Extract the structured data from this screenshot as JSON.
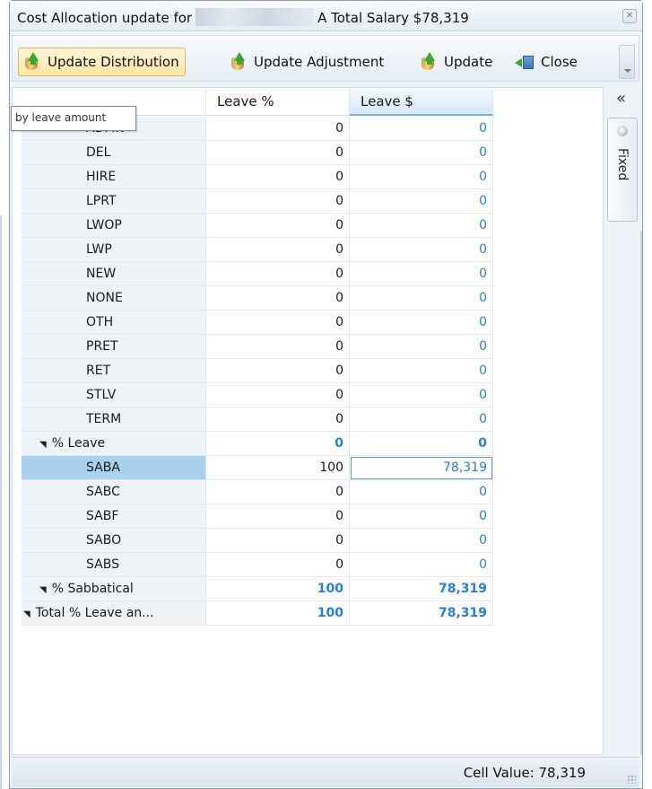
{
  "window": {
    "title_prefix": "Cost Allocation update for",
    "title_suffix": "A Total Salary $78,319",
    "close_glyph": "✕"
  },
  "toolbar": {
    "update_distribution": "Update Distribution",
    "update_adjustment": "Update Adjustment",
    "update": "Update",
    "close": "Close"
  },
  "tooltip": "by leave amount",
  "grid": {
    "headers": [
      "",
      "Leave %",
      "Leave $"
    ],
    "rows": [
      {
        "label": "ADMN",
        "pct": "0",
        "amt": "0"
      },
      {
        "label": "DEL",
        "pct": "0",
        "amt": "0"
      },
      {
        "label": "HIRE",
        "pct": "0",
        "amt": "0"
      },
      {
        "label": "LPRT",
        "pct": "0",
        "amt": "0"
      },
      {
        "label": "LWOP",
        "pct": "0",
        "amt": "0"
      },
      {
        "label": "LWP",
        "pct": "0",
        "amt": "0"
      },
      {
        "label": "NEW",
        "pct": "0",
        "amt": "0"
      },
      {
        "label": "NONE",
        "pct": "0",
        "amt": "0"
      },
      {
        "label": "OTH",
        "pct": "0",
        "amt": "0"
      },
      {
        "label": "PRET",
        "pct": "0",
        "amt": "0"
      },
      {
        "label": "RET",
        "pct": "0",
        "amt": "0"
      },
      {
        "label": "STLV",
        "pct": "0",
        "amt": "0"
      },
      {
        "label": "TERM",
        "pct": "0",
        "amt": "0"
      },
      {
        "label": "% Leave",
        "pct": "0",
        "amt": "0",
        "subtotal": true,
        "indent": 0
      },
      {
        "label": "SABA",
        "pct": "100",
        "amt": "78,319",
        "selected": true
      },
      {
        "label": "SABC",
        "pct": "0",
        "amt": "0"
      },
      {
        "label": "SABF",
        "pct": "0",
        "amt": "0"
      },
      {
        "label": "SABO",
        "pct": "0",
        "amt": "0"
      },
      {
        "label": "SABS",
        "pct": "0",
        "amt": "0"
      },
      {
        "label": "% Sabbatical",
        "pct": "100",
        "amt": "78,319",
        "subtotal": true,
        "indent": 0
      },
      {
        "label": "Total % Leave an...",
        "pct": "100",
        "amt": "78,319",
        "subtotal": true,
        "indent": -1
      }
    ]
  },
  "side": {
    "collapse": "«",
    "fixed_tab": "Fixed"
  },
  "status": {
    "cell_value": "Cell Value: 78,319"
  }
}
